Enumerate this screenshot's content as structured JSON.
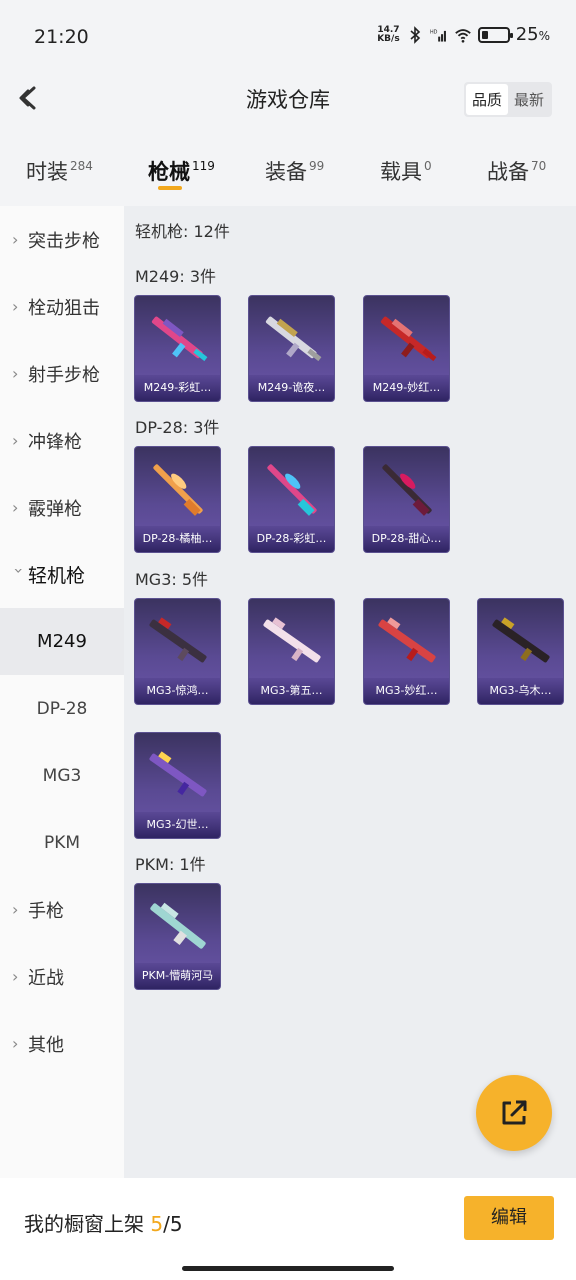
{
  "status": {
    "time": "21:20",
    "net_speed_top": "14.7",
    "net_speed_bottom": "KB/s",
    "wifi_tag": "HD",
    "battery": "25",
    "battery_unit": "%",
    "battery_level": 0.25
  },
  "header": {
    "title": "游戏仓库",
    "sort_options": [
      "品质",
      "最新"
    ],
    "sort_selected": "品质"
  },
  "tabs": [
    {
      "label": "时装",
      "count": "284"
    },
    {
      "label": "枪械",
      "count": "119",
      "active": true
    },
    {
      "label": "装备",
      "count": "99"
    },
    {
      "label": "载具",
      "count": "0"
    },
    {
      "label": "战备",
      "count": "70"
    }
  ],
  "sidebar": {
    "items": [
      {
        "label": "突击步枪",
        "type": "category"
      },
      {
        "label": "栓动狙击",
        "type": "category"
      },
      {
        "label": "射手步枪",
        "type": "category"
      },
      {
        "label": "冲锋枪",
        "type": "category"
      },
      {
        "label": "霰弹枪",
        "type": "category"
      },
      {
        "label": "轻机枪",
        "type": "category",
        "expanded": true
      },
      {
        "label": "M249",
        "type": "sub",
        "active": true
      },
      {
        "label": "DP-28",
        "type": "sub"
      },
      {
        "label": "MG3",
        "type": "sub"
      },
      {
        "label": "PKM",
        "type": "sub"
      },
      {
        "label": "手枪",
        "type": "category"
      },
      {
        "label": "近战",
        "type": "category"
      },
      {
        "label": "其他",
        "type": "category"
      }
    ]
  },
  "content": {
    "total_label": "轻机枪: 12件",
    "groups": [
      {
        "label": "M249: 3件",
        "items": [
          "M249-彩虹…",
          "M249-诡夜…",
          "M249-妙红…"
        ]
      },
      {
        "label": "DP-28: 3件",
        "items": [
          "DP-28-橘柚…",
          "DP-28-彩虹…",
          "DP-28-甜心…"
        ]
      },
      {
        "label": "MG3: 5件",
        "items": [
          "MG3-惊鸿…",
          "MG3-第五…",
          "MG3-妙红…",
          "MG3-乌木…",
          "MG3-幻世…"
        ]
      },
      {
        "label": "PKM: 1件",
        "items": [
          "PKM-懵萌河马"
        ]
      }
    ]
  },
  "bottom": {
    "label": "我的橱窗上架",
    "count_current": "5",
    "count_sep": "/",
    "count_total": "5",
    "edit_label": "编辑"
  },
  "colors": {
    "accent": "#f6b22b",
    "card_bg": "#4b3f80"
  }
}
